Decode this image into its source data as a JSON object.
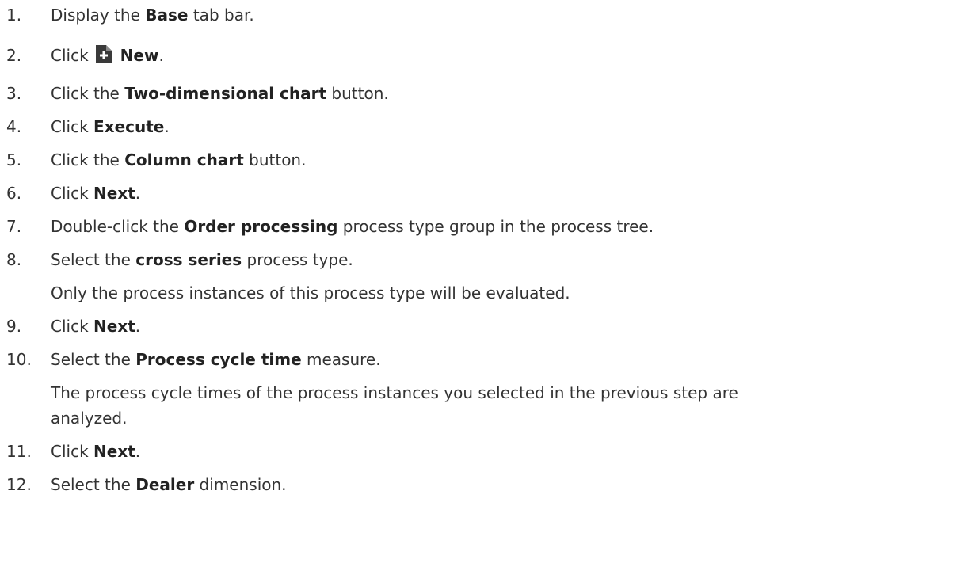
{
  "steps": [
    {
      "num": "1.",
      "pre": "Display the ",
      "bold": "Base",
      "post": " tab bar."
    },
    {
      "num": "2.",
      "pre": "Click",
      "bold": "New",
      "post": ".",
      "icon": "new-document-icon"
    },
    {
      "num": "3.",
      "pre": "Click the ",
      "bold": "Two-dimensional chart",
      "post": " button."
    },
    {
      "num": "4.",
      "pre": "Click ",
      "bold": "Execute",
      "post": "."
    },
    {
      "num": "5.",
      "pre": "Click the ",
      "bold": "Column chart",
      "post": " button."
    },
    {
      "num": "6.",
      "pre": "Click ",
      "bold": "Next",
      "post": "."
    },
    {
      "num": "7.",
      "pre": "Double-click the ",
      "bold": "Order processing",
      "post": " process type group in the process tree."
    },
    {
      "num": "8.",
      "pre": "Select the ",
      "bold": "cross series",
      "post": " process type."
    },
    {
      "num": "9.",
      "pre": "Click ",
      "bold": "Next",
      "post": "."
    },
    {
      "num": "10.",
      "pre": "Select the ",
      "bold": "Process cycle time",
      "post": " measure."
    },
    {
      "num": "11.",
      "pre": "Click ",
      "bold": "Next",
      "post": "."
    },
    {
      "num": "12.",
      "pre": "Select the ",
      "bold": "Dealer",
      "post": " dimension."
    }
  ],
  "notes": {
    "step8": "Only the process instances of this process type will be evaluated.",
    "step10_line1": "The process cycle times of the process instances you selected in the previous step are",
    "step10_line2": "analyzed."
  },
  "colors": {
    "text": "#333333",
    "icon": "#3a3a3a"
  }
}
